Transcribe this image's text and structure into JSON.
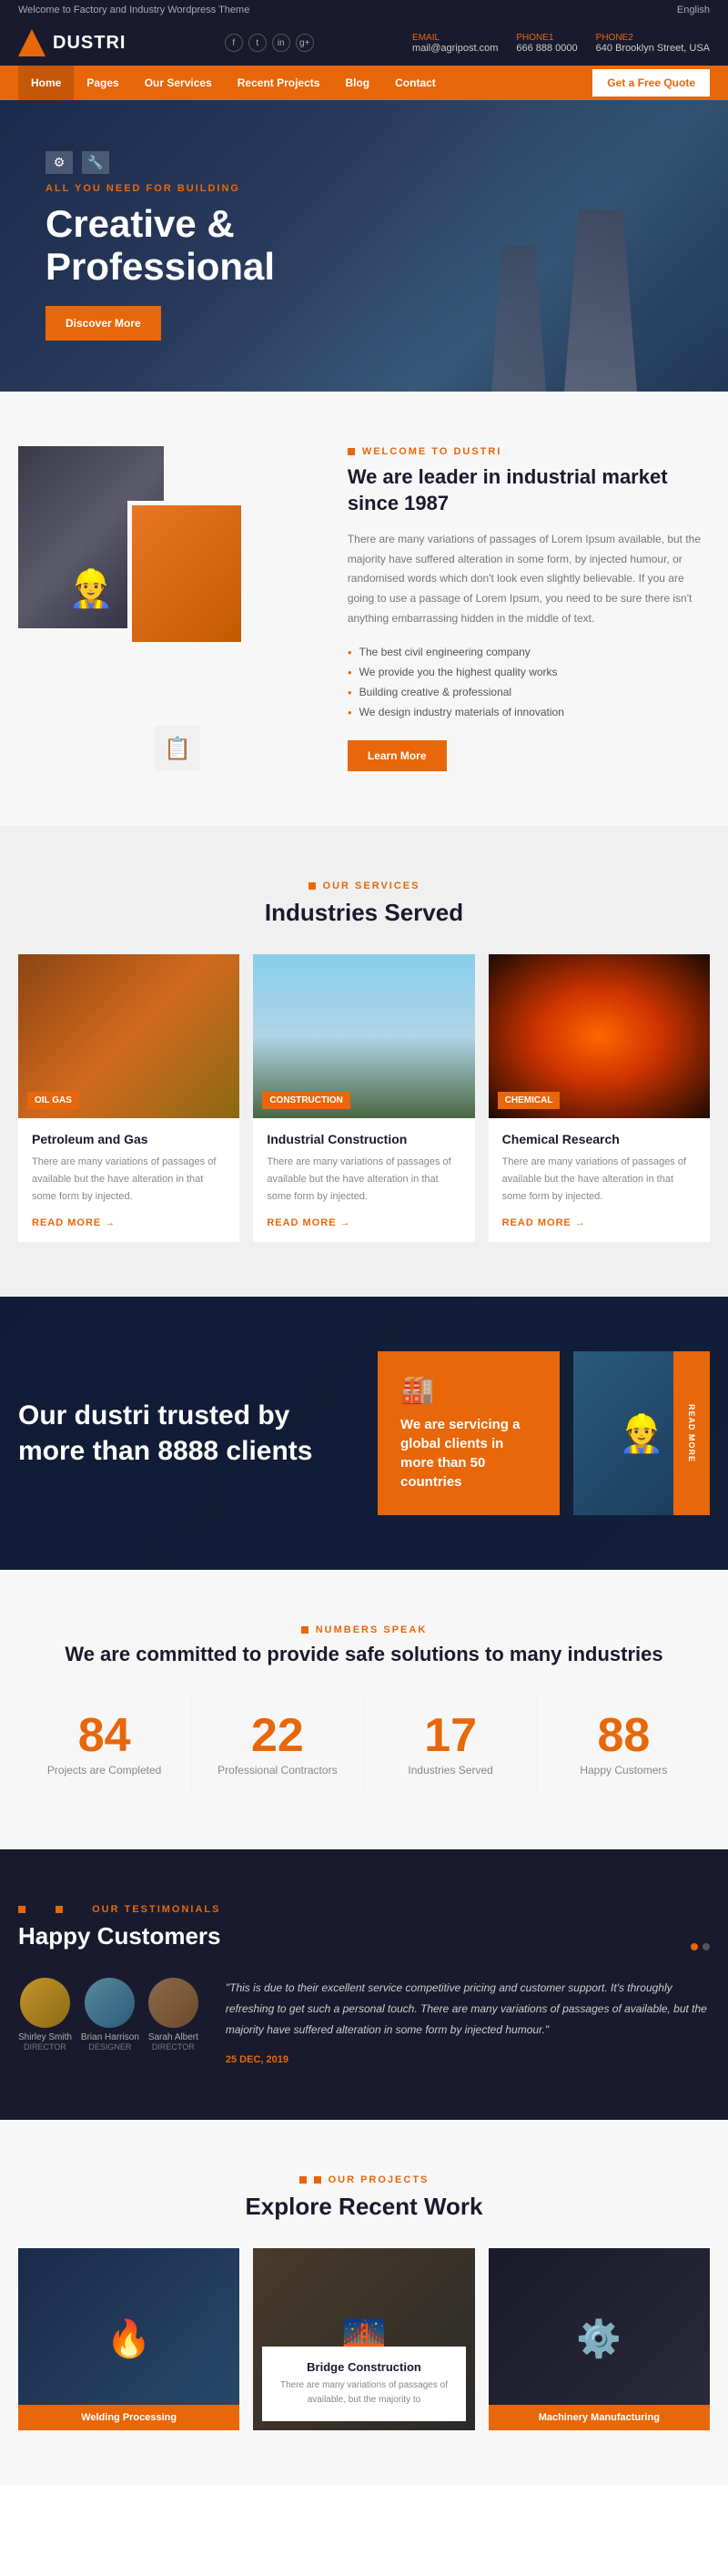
{
  "topbar": {
    "welcome": "Welcome to Factory and Industry Wordpress Theme",
    "language": "English",
    "email_label": "EMAIL",
    "email": "mail@agripost.com",
    "phone_label": "PHONE1",
    "phone": "666 888 0000",
    "address_label": "PHONE2",
    "address": "640 Brooklyn Street, USA"
  },
  "header": {
    "logo_text": "DUSTRI",
    "social": [
      "f",
      "t",
      "in",
      "g+"
    ]
  },
  "nav": {
    "links": [
      "Home",
      "Pages",
      "Our Services",
      "Recent Projects",
      "Blog",
      "Contact"
    ],
    "cta": "Get a Free Quote"
  },
  "hero": {
    "tag1_icon": "⚙",
    "tag2_icon": "🔧",
    "subtitle": "ALL YOU NEED FOR BUILDING",
    "title_line1": "Creative &",
    "title_line2": "Professional",
    "cta": "Discover More"
  },
  "about": {
    "tag": "WELCOME TO DUSTRI",
    "title": "We are leader in industrial market since 1987",
    "description": "There are many variations of passages of Lorem Ipsum available, but the majority have suffered alteration in some form, by injected humour, or randomised words which don't look even slightly believable. If you are going to use a passage of Lorem Ipsum, you need to be sure there isn't anything embarrassing hidden in the middle of text.",
    "features": [
      "The best civil engineering company",
      "We provide you the highest quality works",
      "Building creative & professional",
      "We design industry materials of innovation"
    ],
    "cta": "Learn More"
  },
  "industries": {
    "tag": "OUR SERVICES",
    "title": "Industries Served",
    "cards": [
      {
        "badge": "OIL GAS",
        "title": "Petroleum and Gas",
        "description": "There are many variations of passages of available but the have alteration in that some form by injected.",
        "read_more": "READ MORE →"
      },
      {
        "badge": "CONSTRUCTION",
        "title": "Industrial Construction",
        "description": "There are many variations of passages of available but the have alteration in that some form by injected.",
        "read_more": "READ MORE →"
      },
      {
        "badge": "CHEMICAL",
        "title": "Chemical Research",
        "description": "There are many variations of passages of available but the have alteration in that some form by injected.",
        "read_more": "READ MORE →"
      }
    ]
  },
  "trust": {
    "title": "Our dustri trusted by more than 8888 clients",
    "orange_box_icon": "🏭",
    "orange_box_text": "We are servicing a global clients in more than 50 countries",
    "image_label": "READ MORE"
  },
  "stats": {
    "tag": "NUMBERS SPEAK",
    "title": "We are committed to provide safe solutions to many industries",
    "items": [
      {
        "number": "84",
        "label": "Projects are Completed"
      },
      {
        "number": "22",
        "label": "Professional Contractors"
      },
      {
        "number": "17",
        "label": "Industries Served"
      },
      {
        "number": "88",
        "label": "Happy Customers"
      }
    ]
  },
  "testimonials": {
    "tag": "OUR TESTIMONIALS",
    "title": "Happy Customers",
    "people": [
      {
        "name": "Shirley Smith",
        "role": "DIRECTOR"
      },
      {
        "name": "Brian Harrison",
        "role": "DESIGNER"
      },
      {
        "name": "Sarah Albert",
        "role": "DIRECTOR"
      }
    ],
    "quote": "\"This is due to their excellent service competitive pricing and customer support. It's throughly refreshing to get such a personal touch. There are many variations of passages of available, but the majority have suffered alteration in some form by injected humour.\"",
    "date": "25 DEC, 2019",
    "dots": [
      true,
      false
    ]
  },
  "projects": {
    "tag": "OUR PROJECTS",
    "title": "Explore Recent Work",
    "items": [
      {
        "title": "Welding Processing",
        "badge": "Welding Processing"
      },
      {
        "title": "Bridge Construction",
        "description": "There are many variations of passages of available, but the majority to",
        "overlay": true
      },
      {
        "title": "Machinery Manufacturing",
        "badge": "Machinery Manufacturing"
      }
    ]
  }
}
